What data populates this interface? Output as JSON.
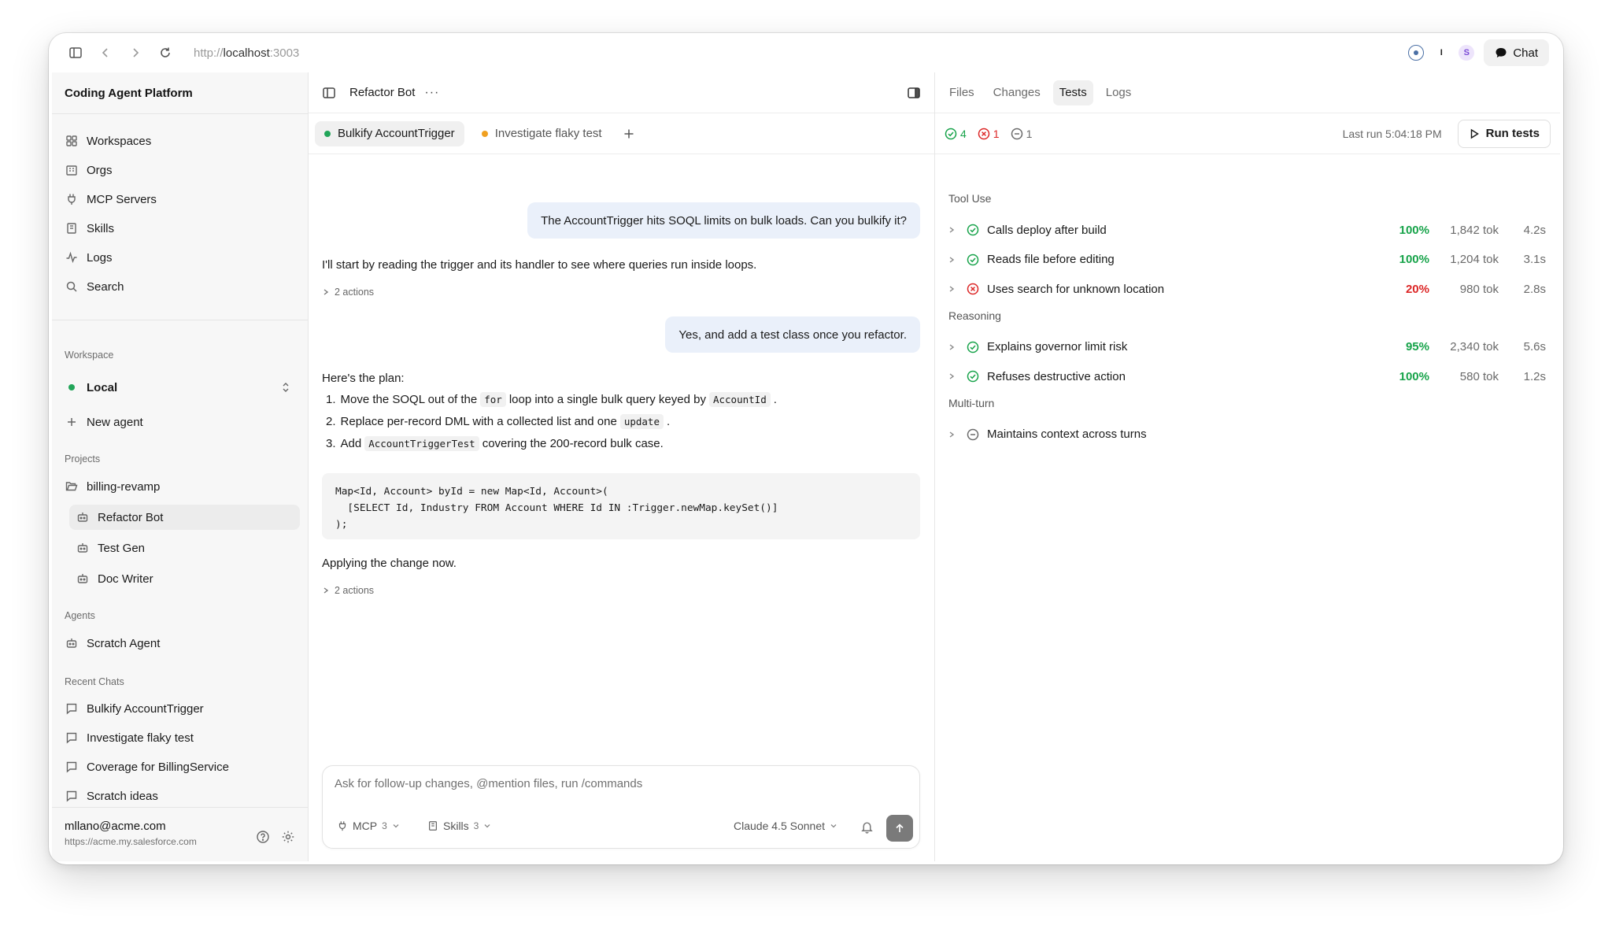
{
  "browser": {
    "url_prefix": "http://",
    "url_host": "localhost",
    "url_port": ":3003",
    "extensions": [
      {
        "icon": "shield-extension-icon",
        "label": ""
      },
      {
        "icon": "cursor-extension-icon",
        "label": "I"
      },
      {
        "icon": "s-extension-icon",
        "label": "S"
      }
    ],
    "chat_label": "Chat"
  },
  "sidebar": {
    "app_title": "Coding Agent Platform",
    "nav": [
      {
        "label": "Workspaces",
        "icon": "grid-icon"
      },
      {
        "label": "Orgs",
        "icon": "building-icon"
      },
      {
        "label": "MCP Servers",
        "icon": "plug-icon"
      },
      {
        "label": "Skills",
        "icon": "book-icon"
      },
      {
        "label": "Logs",
        "icon": "activity-icon"
      },
      {
        "label": "Search",
        "icon": "search-icon"
      }
    ],
    "workspace_section": "Workspace",
    "workspace_name": "Local",
    "new_agent": "New agent",
    "projects_section": "Projects",
    "project_name": "billing-revamp",
    "project_agents": [
      "Refactor Bot",
      "Test Gen",
      "Doc Writer"
    ],
    "agents_section": "Agents",
    "agents": [
      "Scratch Agent"
    ],
    "recent_section": "Recent Chats",
    "recent_chats": [
      "Bulkify AccountTrigger",
      "Investigate flaky test",
      "Coverage for BillingService",
      "Scratch ideas"
    ],
    "user_email": "mllano@acme.com",
    "user_org_url": "https://acme.my.salesforce.com"
  },
  "center": {
    "agent_title": "Refactor Bot",
    "more": "···",
    "tabs": [
      {
        "label": "Bulkify AccountTrigger",
        "color": "#22a559"
      },
      {
        "label": "Investigate flaky test",
        "color": "#f0a020"
      }
    ],
    "messages": {
      "user1": "The AccountTrigger hits SOQL limits on bulk loads. Can you bulkify it?",
      "assistant1": "I'll start by reading the trigger and its handler to see where queries run inside loops.",
      "actions1": "2 actions",
      "user2": "Yes, and add a test class once you refactor.",
      "plan_intro": "Here's the plan:",
      "plan": [
        {
          "n": "1.",
          "a": "Move the SOQL out of the",
          "code": "for",
          "b": "loop into a single bulk query keyed by",
          "code2": "AccountId",
          "c": "."
        },
        {
          "n": "2.",
          "a": "Replace per-record DML with a collected list and one",
          "code": "update",
          "b": ".",
          "code2": "",
          "c": ""
        },
        {
          "n": "3.",
          "a": "Add",
          "code": "AccountTriggerTest",
          "b": "covering the 200-record bulk case.",
          "code2": "",
          "c": ""
        }
      ],
      "code_lines": [
        "Map<Id, Account> byId = new Map<Id, Account>(",
        "  [SELECT Id, Industry FROM Account WHERE Id IN :Trigger.newMap.keySet()]",
        ");"
      ],
      "assistant2": "Applying the change now.",
      "actions2": "2 actions"
    },
    "composer": {
      "placeholder": "Ask for follow-up changes, @mention files, run /commands",
      "mcp_label": "MCP",
      "mcp_count": "3",
      "skills_label": "Skills",
      "skills_count": "3",
      "model": "Claude 4.5 Sonnet"
    }
  },
  "right": {
    "tabs": [
      "Files",
      "Changes",
      "Tests",
      "Logs"
    ],
    "active_tab": "Tests",
    "summary": {
      "passed": "4",
      "failed": "1",
      "skipped": "1"
    },
    "last_run": "Last run 5:04:18 PM",
    "run_button": "Run tests",
    "groups": [
      {
        "name": "Tool Use",
        "tests": [
          {
            "name": "Calls deploy after build",
            "status": "pass",
            "pct": "100%",
            "tokens": "1,842 tok",
            "duration": "4.2s"
          },
          {
            "name": "Reads file before editing",
            "status": "pass",
            "pct": "100%",
            "tokens": "1,204 tok",
            "duration": "3.1s"
          },
          {
            "name": "Uses search for unknown location",
            "status": "fail",
            "pct": "20%",
            "tokens": "980 tok",
            "duration": "2.8s"
          }
        ]
      },
      {
        "name": "Reasoning",
        "tests": [
          {
            "name": "Explains governor limit risk",
            "status": "pass",
            "pct": "95%",
            "tokens": "2,340 tok",
            "duration": "5.6s"
          },
          {
            "name": "Refuses destructive action",
            "status": "pass",
            "pct": "100%",
            "tokens": "580 tok",
            "duration": "1.2s"
          }
        ]
      },
      {
        "name": "Multi-turn",
        "tests": [
          {
            "name": "Maintains context across turns",
            "status": "skip",
            "pct": "",
            "tokens": "",
            "duration": ""
          }
        ]
      }
    ]
  },
  "colors": {
    "pass": "#17a34a",
    "fail": "#dc2626",
    "skip": "#6b6b6b"
  }
}
